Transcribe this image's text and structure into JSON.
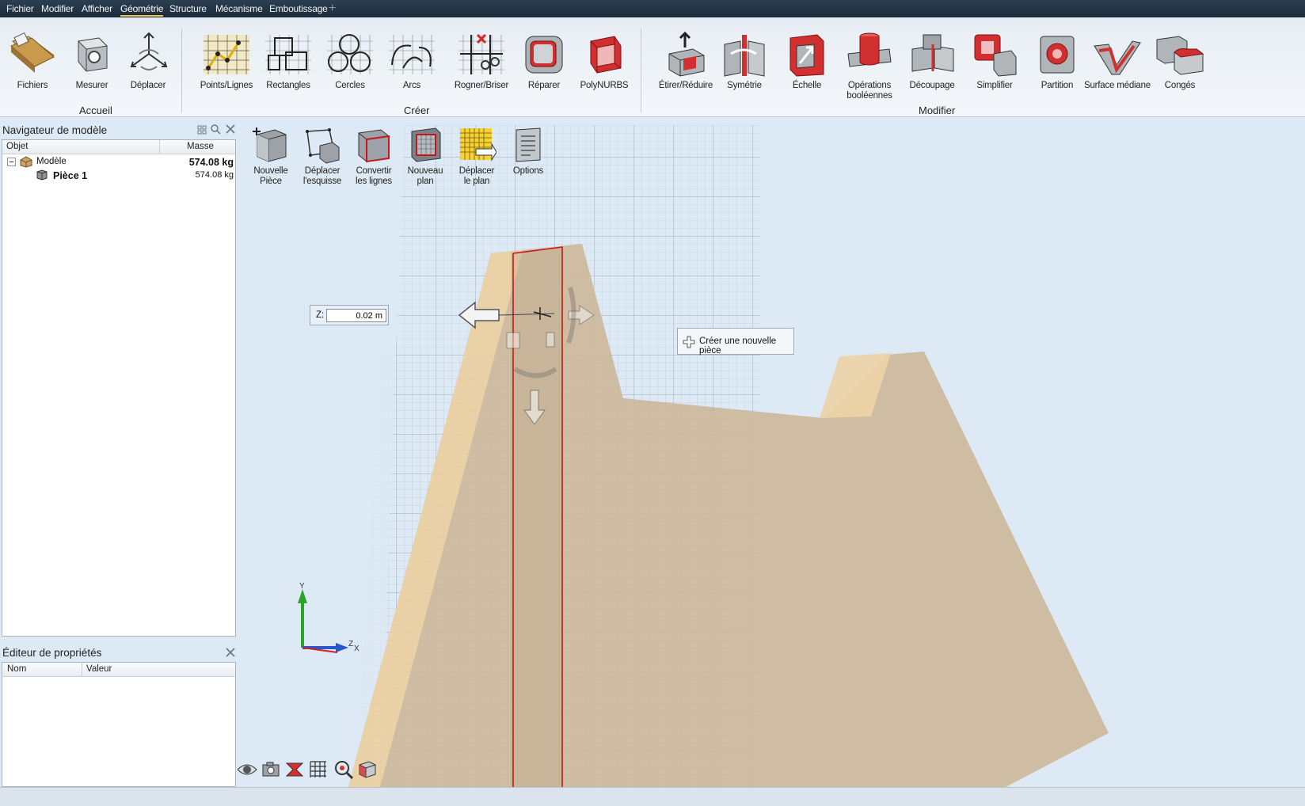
{
  "menu": {
    "items": [
      "Fichier",
      "Modifier",
      "Afficher",
      "Géométrie",
      "Structure",
      "Mécanisme",
      "Emboutissage"
    ],
    "active": "Géométrie",
    "add_icon": "plus-icon"
  },
  "ribbon": {
    "groups": {
      "accueil": "Accueil",
      "creer": "Créer",
      "modifier": "Modifier"
    },
    "buttons": {
      "fichiers": "Fichiers",
      "mesurer": "Mesurer",
      "deplacer": "Déplacer",
      "points_lignes": "Points/Lignes",
      "rectangles": "Rectangles",
      "cercles": "Cercles",
      "arcs": "Arcs",
      "rogner": "Rogner/Briser",
      "reparer": "Réparer",
      "polynurbs": "PolyNURBS",
      "etirer": "Étirer/Réduire",
      "symetrie": "Symétrie",
      "echelle": "Échelle",
      "booleennes_1": "Opérations",
      "booleennes_2": "booléennes",
      "decoupage": "Découpage",
      "simplifier": "Simplifier",
      "partition": "Partition",
      "surface_mediane": "Surface médiane",
      "conges": "Congés"
    }
  },
  "navigator": {
    "title": "Navigateur de modèle",
    "columns": {
      "object": "Objet",
      "mass": "Masse"
    },
    "rows": [
      {
        "name": "Modèle",
        "mass": "574.08 kg"
      },
      {
        "name": "Pièce 1",
        "mass": "574.08 kg"
      }
    ]
  },
  "properties": {
    "title": "Éditeur de propriétés",
    "columns": {
      "name": "Nom",
      "value": "Valeur"
    }
  },
  "sketch_toolbar": {
    "nouvelle_1": "Nouvelle",
    "nouvelle_2": "Pièce",
    "deplacer_esq_1": "Déplacer",
    "deplacer_esq_2": "l'esquisse",
    "convertir_1": "Convertir",
    "convertir_2": "les lignes",
    "nouveau_plan_1": "Nouveau",
    "nouveau_plan_2": "plan",
    "deplacer_plan_1": "Déplacer",
    "deplacer_plan_2": "le plan",
    "options": "Options"
  },
  "z_input": {
    "label": "Z:",
    "value": "0.02 m"
  },
  "tooltip": {
    "text": "Créer une nouvelle pièce"
  },
  "axes": {
    "y": "Y",
    "z": "Z",
    "x": "X"
  },
  "colors": {
    "part": "#cdb99b",
    "part_light": "#ecd3a6",
    "sketch_plane": "#c81616",
    "grid": "#8d9aa7",
    "menubar": "#22364a"
  }
}
